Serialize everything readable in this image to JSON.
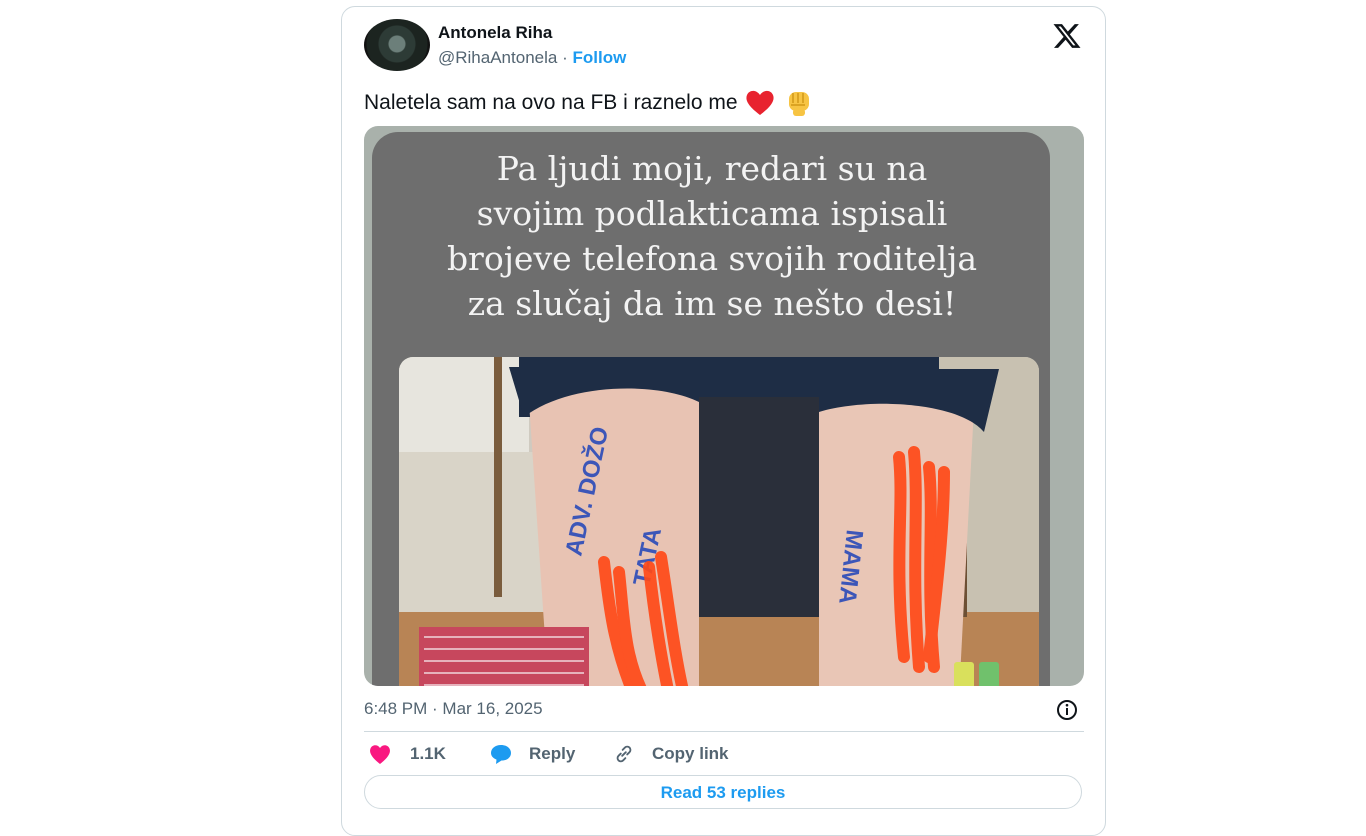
{
  "author": {
    "name": "Antonela Riha",
    "handle": "@RihaAntonela",
    "separator": "·",
    "follow_label": "Follow"
  },
  "tweet": {
    "text": "Naletela sam na ovo na FB i raznelo me",
    "emojis": [
      "red-heart-icon",
      "raised-fist-icon"
    ],
    "image_caption_lines": [
      "Pa ljudi moji, redari su na",
      "svojim podlakticama ispisali",
      "brojeve telefona svojih roditelja",
      "za slučaj da im se nešto desi!"
    ],
    "arm_text": {
      "left_1": "ADV. DOŽO",
      "left_2": "TATA",
      "right": "MAMA"
    },
    "timestamp": "6:48 PM · Mar 16, 2025"
  },
  "actions": {
    "likes": "1.1K",
    "reply_label": "Reply",
    "copy_link_label": "Copy link",
    "read_replies_label": "Read 53 replies"
  },
  "colors": {
    "accent": "#1d9bf0",
    "like": "#f91880",
    "muted": "#536471",
    "border": "#cfd9de"
  }
}
